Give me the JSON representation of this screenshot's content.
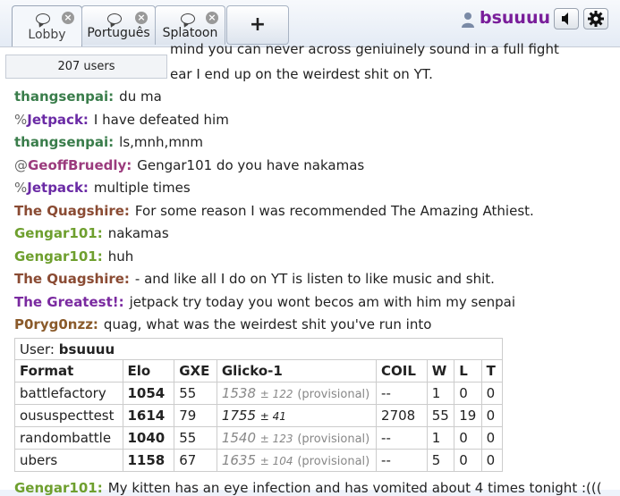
{
  "tabs": [
    {
      "label": "Lobby",
      "active": true
    },
    {
      "label": "Português",
      "active": false
    },
    {
      "label": "Splatoon",
      "active": false
    }
  ],
  "new_tab_label": "+",
  "user": {
    "name": "bsuuuu"
  },
  "userlist_count": "207 users",
  "messages": [
    {
      "rank": "",
      "name": "",
      "color": "#3a7d4b",
      "text": "mind you can never across geniuinely sound in a full fight"
    },
    {
      "rank": "",
      "name": "",
      "color": "#3a7d4b",
      "text": "ear I end up on the weirdest shit on YT."
    },
    {
      "rank": "",
      "name": "thangsenpai:",
      "color": "#3a7d4b",
      "text": "du ma"
    },
    {
      "rank": "%",
      "name": "Jetpack:",
      "color": "#6a2aa5",
      "text": "I have defeated him"
    },
    {
      "rank": "",
      "name": "thangsenpai:",
      "color": "#3a7d4b",
      "text": "ls,mnh,mnm"
    },
    {
      "rank": "@",
      "name": "GeoffBruedly:",
      "color": "#9b3b7d",
      "text": "Gengar101 do you have nakamas"
    },
    {
      "rank": "%",
      "name": "Jetpack:",
      "color": "#6a2aa5",
      "text": "multiple times"
    },
    {
      "rank": "",
      "name": "The Quagshire:",
      "color": "#8a4b33",
      "text": "For some reason I was recommended The Amazing Athiest."
    },
    {
      "rank": "",
      "name": "Gengar101:",
      "color": "#6e9f2e",
      "text": "nakamas"
    },
    {
      "rank": "",
      "name": "Gengar101:",
      "color": "#6e9f2e",
      "text": "huh"
    },
    {
      "rank": "",
      "name": "The Quagshire:",
      "color": "#8a4b33",
      "text": "- and like all I do on YT is listen to like music and shit."
    },
    {
      "rank": "",
      "name": "The Greatest!:",
      "color": "#7a2aa0",
      "text": "jetpack try today you wont becos am with him my senpai"
    },
    {
      "rank": "",
      "name": "P0ryg0nzz:",
      "color": "#8a5a2a",
      "text": "quag, what was the weirdest shit you've run into"
    },
    {
      "rank": "",
      "name": "Gengar101:",
      "color": "#6e9f2e",
      "text": "My kitten has an eye infection and has vomited about 4 times tonight :((("
    }
  ],
  "rating": {
    "user_label": "User:",
    "user_name": "bsuuuu",
    "headers": [
      "Format",
      "Elo",
      "GXE",
      "Glicko-1",
      "COIL",
      "W",
      "L",
      "T"
    ],
    "rows": [
      {
        "format": "battlefactory",
        "elo": "1054",
        "gxe": "55",
        "glicko": "1538",
        "dev": "± 122",
        "prov": "(provisional)",
        "coil": "--",
        "w": "1",
        "l": "0",
        "t": "0"
      },
      {
        "format": "oususpecttest",
        "elo": "1614",
        "gxe": "79",
        "glicko": "1755",
        "dev": "± 41",
        "prov": "",
        "coil": "2708",
        "w": "55",
        "l": "19",
        "t": "0"
      },
      {
        "format": "randombattle",
        "elo": "1040",
        "gxe": "55",
        "glicko": "1540",
        "dev": "± 123",
        "prov": "(provisional)",
        "coil": "--",
        "w": "1",
        "l": "0",
        "t": "0"
      },
      {
        "format": "ubers",
        "elo": "1158",
        "gxe": "67",
        "glicko": "1635",
        "dev": "± 104",
        "prov": "(provisional)",
        "coil": "--",
        "w": "5",
        "l": "0",
        "t": "0"
      }
    ]
  },
  "colors": {
    "accent_user": "#791e9a"
  }
}
